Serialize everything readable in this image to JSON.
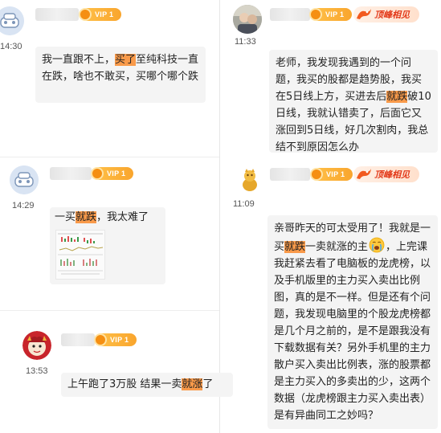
{
  "vip_label": "VIP 1",
  "peak_badge": "顶峰相见",
  "emoji_label": "crying-face-emoji",
  "highlight_color": "#f99a4a",
  "messages": [
    {
      "time": "14:30",
      "avatar": "robot-car-avatar",
      "text_a": "我一直跟不上，",
      "text_hl": "买了",
      "text_b": "至纯科技一直在跌，啥也不敢买，买哪个哪个跌"
    },
    {
      "time": "11:33",
      "avatar": "photo-avatar",
      "text_a": "老师，我发现我遇到的一个问题，我买的股都是趋势股，我买在5日线上方，买进去后",
      "text_hl": "就跌",
      "text_b": "破10日线，我就认错卖了，后面它又涨回到5日线，好几次割肉，我总结不到原因怎么办"
    },
    {
      "time": "14:29",
      "avatar": "robot-car-avatar",
      "text_a": "一买",
      "text_hl": "就跌",
      "text_b": "，我太难了",
      "image": "stock-chart-screenshot-thumbnail"
    },
    {
      "time": "11:09",
      "avatar": "gold-mascot-avatar",
      "text_a": "亲哥昨天的可太受用了！我就是一买",
      "text_hl": "就跌",
      "text_b": "一卖就涨的主",
      "text_c": "，上完课我赶紧去看了电脑板的龙虎榜，以及手机版里的主力买入卖出比例图，真的是不一样。但是还有个问题，我发现电脑里的个股龙虎榜都是几个月之前的，是不是跟我没有下载数据有关？另外手机里的主力散户买入卖出比例表，涨的股票都是主力买入的多卖出的少，这两个数据（龙虎榜跟主力买入卖出表）是有异曲同工之妙吗？"
    },
    {
      "time": "13:53",
      "avatar": "red-dragon-avatar",
      "text_a": "上午跑了3万股 结果一卖",
      "text_hl": "就涨",
      "text_b": "了"
    }
  ]
}
